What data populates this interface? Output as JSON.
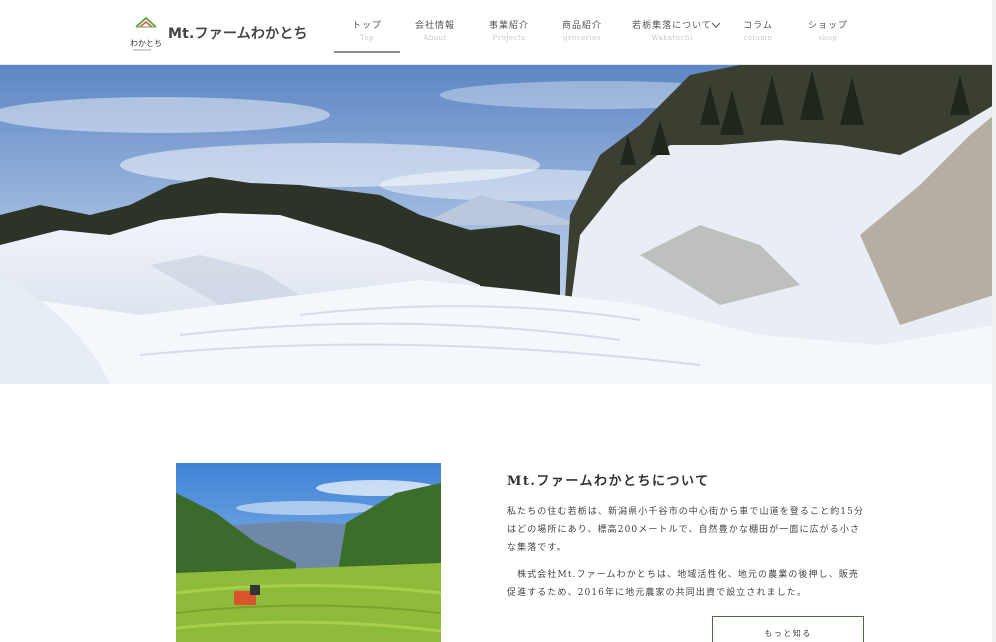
{
  "brand": {
    "name": "Mt.ファームわかとち",
    "mark_text": "わかとち",
    "mark_subtext": "WAKATOCHI"
  },
  "nav": {
    "items": [
      {
        "jp": "トップ",
        "en": "Top",
        "active": true
      },
      {
        "jp": "会社情報",
        "en": "About"
      },
      {
        "jp": "事業紹介",
        "en": "Projects"
      },
      {
        "jp": "商品紹介",
        "en": "groceries"
      },
      {
        "jp": "若栃集落について",
        "en": "Wakatochi",
        "has_dropdown": true
      },
      {
        "jp": "コラム",
        "en": "column"
      },
      {
        "jp": "ショップ",
        "en": "shop"
      }
    ]
  },
  "about": {
    "title": "Mt.ファームわかとちについて",
    "paragraph1": "私たちの住む若栃は、新潟県小千谷市の中心街から車で山道を登ること約15分はどの場所にあり、標高200メートルで、自然豊かな棚田が一面に広がる小さな集落です。",
    "paragraph2": "　株式会社Mt.ファームわかとちは、地域活性化、地元の農業の後押し、販売促進するため、2016年に地元農家の共同出資で設立されました。",
    "more_label": "もっと知る"
  },
  "colors": {
    "accent_green": "#4a6b3a",
    "logo_green": "#6aa84f",
    "logo_red": "#d9534f"
  }
}
